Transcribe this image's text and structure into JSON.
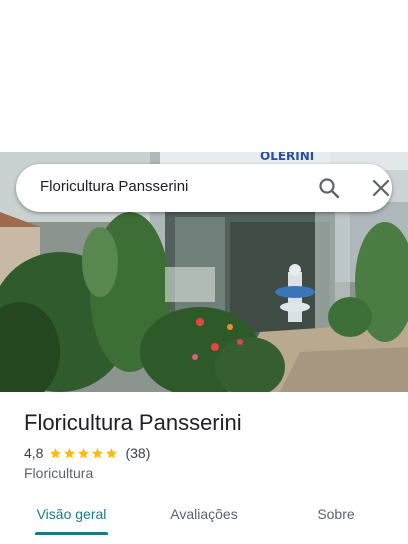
{
  "search": {
    "query": "Floricultura Pansserini"
  },
  "place": {
    "name": "Floricultura Pansserini",
    "rating": "4,8",
    "rating_stars": 4.8,
    "reviews": "(38)",
    "category": "Floricultura"
  },
  "tabs": [
    {
      "label": "Visão geral",
      "active": true
    },
    {
      "label": "Avaliações",
      "active": false
    },
    {
      "label": "Sobre",
      "active": false
    }
  ],
  "colors": {
    "accent": "#1a7a83",
    "star": "#fbbc04"
  },
  "icons": {
    "search": "search-icon",
    "close": "close-icon",
    "star": "star-icon"
  }
}
